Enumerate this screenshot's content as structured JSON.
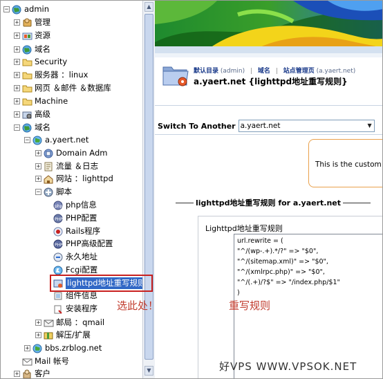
{
  "tree": {
    "items": [
      {
        "label": "admin",
        "icon": "admin-globe-icon",
        "toggle": "−"
      },
      {
        "label": "管理",
        "icon": "manage-icon",
        "toggle": "+"
      },
      {
        "label": "资源",
        "icon": "resource-icon",
        "toggle": "+"
      },
      {
        "label": "域名",
        "icon": "globe-icon",
        "toggle": "+"
      },
      {
        "label": "Security",
        "icon": "folder-icon",
        "toggle": "+"
      },
      {
        "label": "服务器 ：linux",
        "icon": "folder-icon",
        "toggle": "+"
      },
      {
        "label": "网页 ＆邮件 ＆数据库",
        "icon": "folder-icon",
        "toggle": "+"
      },
      {
        "label": "Machine",
        "icon": "folder-icon",
        "toggle": "+"
      },
      {
        "label": "高级",
        "icon": "advanced-icon",
        "toggle": "+"
      },
      {
        "label": "域名",
        "icon": "globe-icon",
        "toggle": "−"
      },
      {
        "label": "a.yaert.net",
        "icon": "domain-globe-icon",
        "toggle": "−"
      },
      {
        "label": "Domain Adm",
        "icon": "domain-admin-icon",
        "toggle": "+"
      },
      {
        "label": "流量 ＆日志",
        "icon": "traffic-log-icon",
        "toggle": "+"
      },
      {
        "label": "网站 ：lighttpd",
        "icon": "website-icon",
        "toggle": "+"
      },
      {
        "label": "脚本",
        "icon": "script-icon",
        "toggle": "−"
      },
      {
        "label": "php信息",
        "icon": "php-icon",
        "toggle": ""
      },
      {
        "label": "PHP配置",
        "icon": "php-config-icon",
        "toggle": ""
      },
      {
        "label": "Rails程序",
        "icon": "rails-icon",
        "toggle": ""
      },
      {
        "label": "PHP高级配置",
        "icon": "php-advanced-icon",
        "toggle": ""
      },
      {
        "label": "永久地址",
        "icon": "permalink-icon",
        "toggle": ""
      },
      {
        "label": "Fcgi配置",
        "icon": "fcgi-icon",
        "toggle": ""
      },
      {
        "label": "lighttpd地址重写规则",
        "icon": "rewrite-rule-icon",
        "toggle": ""
      },
      {
        "label": "组件信息",
        "icon": "component-icon",
        "toggle": ""
      },
      {
        "label": "安装程序",
        "icon": "installer-icon",
        "toggle": ""
      },
      {
        "label": "邮局 ：qmail",
        "icon": "mail-icon",
        "toggle": "+"
      },
      {
        "label": "解压/扩展",
        "icon": "extract-icon",
        "toggle": "+"
      },
      {
        "label": "bbs.zrblog.net",
        "icon": "domain-globe-icon",
        "toggle": "+"
      },
      {
        "label": "Mail 帐号",
        "icon": "mail-account-icon",
        "toggle": ""
      },
      {
        "label": "客户",
        "icon": "client-icon",
        "toggle": "+"
      }
    ]
  },
  "breadcrumb": {
    "home": "默认目录",
    "home_user": "(admin)",
    "domain": "域名",
    "site_admin": "站点管理页",
    "site_admin_domain": "(a.yaert.net)"
  },
  "page_title": "a.yaert.net {lighttpd地址重写规则}",
  "switch": {
    "label": "Switch To Another",
    "value": "a.yaert.net"
  },
  "info_text": "This is the custom lig",
  "section_title": "lighttpd地址重写规则  for a.yaert.net",
  "editor": {
    "label": "Lighttpd地址重写规则",
    "lines": [
      "url.rewrite = (",
      "\"^/(wp-.+).*/?\" => \"$0\",",
      "\"^/(sitemap.xml)\" => \"$0\",",
      "\"^/(xmlrpc.php)\" => \"$0\",",
      "\"^/(.+)/?$\" => \"/index.php/$1\"",
      ")"
    ]
  },
  "annotations": {
    "select_here": "选此处！",
    "rewrite_rules": "重写规则"
  },
  "watermark": "好VPS WWW.VPSOK.NET",
  "colors": {
    "highlight": "#c8201e",
    "annotation": "#c0392b",
    "selection": "#3168c6",
    "accent_orange": "#e9a04a"
  }
}
